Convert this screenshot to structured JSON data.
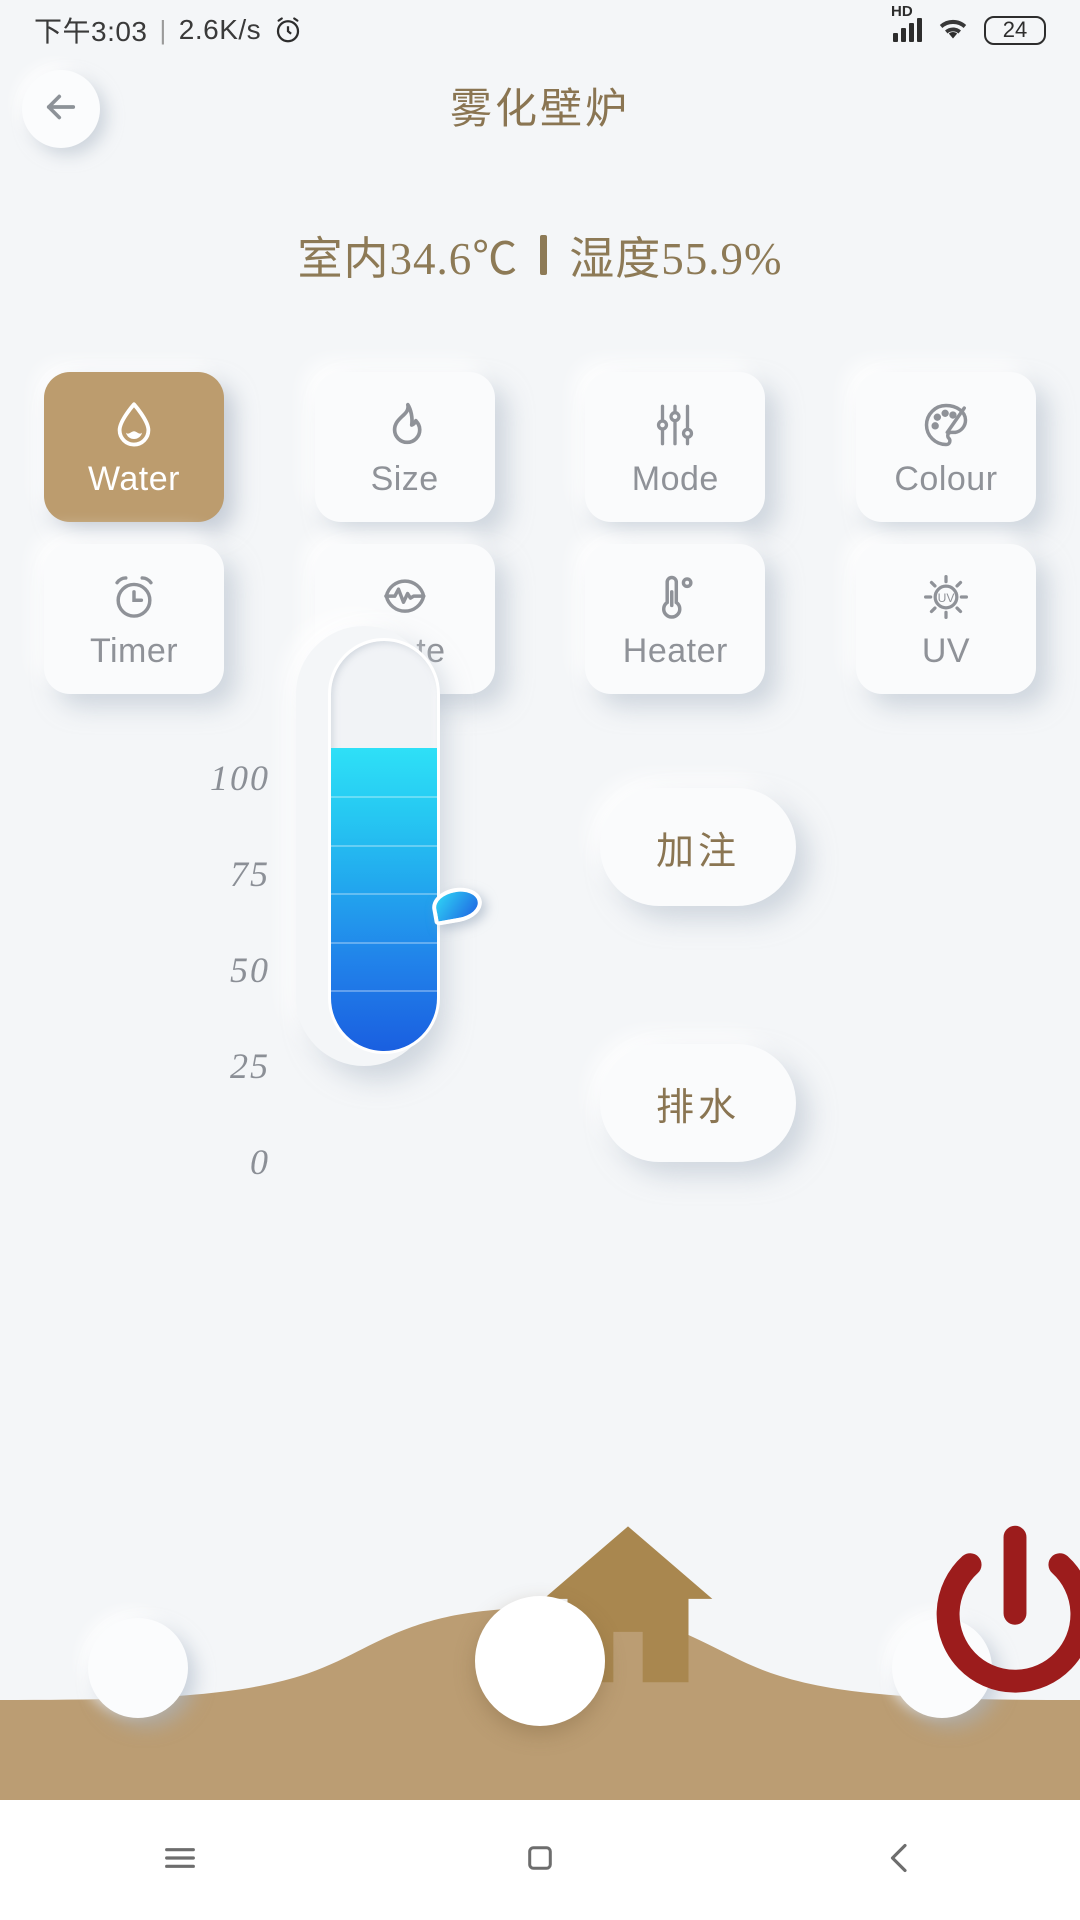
{
  "status_bar": {
    "time": "下午3:03",
    "separator": "|",
    "network_speed": "2.6K/s",
    "alarm_icon": "alarm-clock-icon",
    "hd_label": "HD",
    "signal_icon": "cellular-signal-icon",
    "wifi_icon": "wifi-icon",
    "battery_level": "24"
  },
  "header": {
    "back_icon": "back-arrow-icon",
    "title": "雾化壁炉"
  },
  "environment": {
    "indoor_temperature": "室内34.6℃",
    "divider": "|",
    "humidity": "湿度55.9%"
  },
  "feature_grid": {
    "rows": [
      [
        {
          "label": "Water",
          "icon": "water-drop-icon",
          "active": true
        },
        {
          "label": "Size",
          "icon": "flame-icon",
          "active": false
        },
        {
          "label": "Mode",
          "icon": "sliders-icon",
          "active": false
        },
        {
          "label": "Colour",
          "icon": "palette-icon",
          "active": false
        }
      ],
      [
        {
          "label": "Timer",
          "icon": "alarm-clock-icon",
          "active": false
        },
        {
          "label": "State",
          "icon": "waveform-circle-icon",
          "active": false
        },
        {
          "label": "Heater",
          "icon": "thermometer-icon",
          "active": false
        },
        {
          "label": "UV",
          "icon": "uv-sun-icon",
          "active": false
        }
      ]
    ]
  },
  "water_slider": {
    "scale_labels": [
      "100",
      "75",
      "50",
      "25",
      "0"
    ],
    "value": 74,
    "min": 0,
    "max": 100,
    "handle_icon": "water-drop-handle-icon",
    "fill_top_color": "#2ee0f7",
    "fill_bottom_color": "#1a5fe0"
  },
  "actions": {
    "fill_label": "加注",
    "drain_label": "排水"
  },
  "bottom_bar": {
    "wave_color": "#bb9d73",
    "home_icon": "home-icon",
    "search_icon": "magnifier-icon",
    "power_icon": "power-icon",
    "power_color": "#9c1c1c"
  },
  "android_nav": {
    "menu_icon": "menu-icon",
    "home_icon": "square-home-icon",
    "back_icon": "chevron-back-icon"
  },
  "theme": {
    "accent": "#bc9c6e",
    "background": "#f4f6f8",
    "text_muted": "#8f9298",
    "text_brand": "#8a7552"
  }
}
